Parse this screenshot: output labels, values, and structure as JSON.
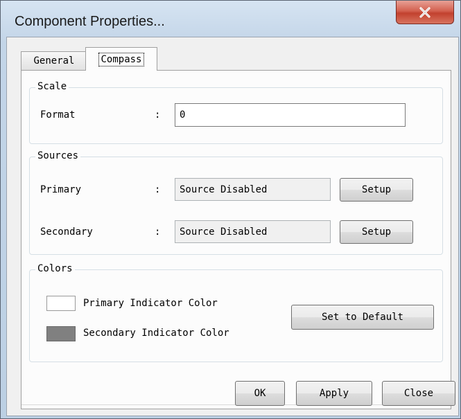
{
  "window": {
    "title": "Component Properties...",
    "close_icon": "close-x-icon"
  },
  "tabs": [
    {
      "label": "General",
      "selected": false
    },
    {
      "label": "Compass",
      "selected": true
    }
  ],
  "scale": {
    "title": "Scale",
    "format_label": "Format",
    "format_sep": ":",
    "format_value": "0"
  },
  "sources": {
    "title": "Sources",
    "primary_label": "Primary",
    "primary_sep": ":",
    "primary_value": "Source Disabled",
    "primary_setup": "Setup",
    "secondary_label": "Secondary",
    "secondary_sep": ":",
    "secondary_value": "Source Disabled",
    "secondary_setup": "Setup"
  },
  "colors": {
    "title": "Colors",
    "primary_label": "Primary Indicator Color",
    "primary_color": "#ffffff",
    "secondary_label": "Secondary Indicator Color",
    "secondary_color": "#808080",
    "default_button": "Set to Default"
  },
  "footer": {
    "ok": "OK",
    "apply": "Apply",
    "close": "Close"
  }
}
